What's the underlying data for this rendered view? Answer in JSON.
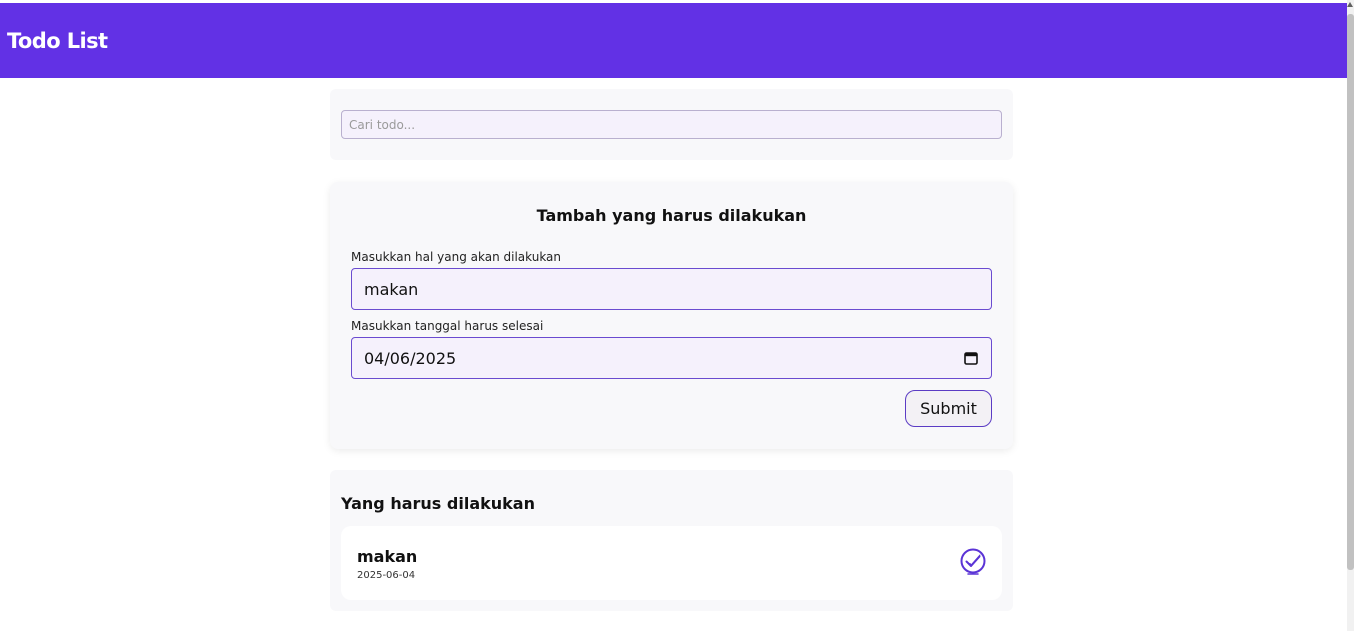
{
  "header": {
    "title": "Todo List"
  },
  "search": {
    "placeholder": "Cari todo..."
  },
  "form": {
    "title": "Tambah yang harus dilakukan",
    "task_label": "Masukkan hal yang akan dilakukan",
    "task_value": "makan",
    "date_label": "Masukkan tanggal harus selesai",
    "date_value": "04/06/2025",
    "submit_label": "Submit",
    "calendar_icon": "calendar-icon"
  },
  "list": {
    "title": "Yang harus dilakukan",
    "items": [
      {
        "text": "makan",
        "date": "2025-06-04",
        "icon": "check-circle-icon"
      }
    ]
  },
  "colors": {
    "accent": "#6231e5",
    "input_bg": "#f5f1fc",
    "card_bg": "#f8f8fa"
  }
}
